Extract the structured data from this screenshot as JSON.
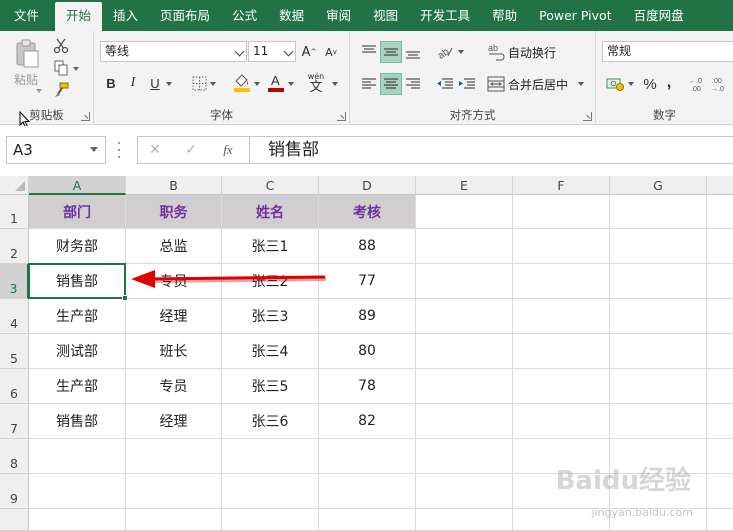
{
  "ribbon_tabs": [
    "文件",
    "开始",
    "插入",
    "页面布局",
    "公式",
    "数据",
    "审阅",
    "视图",
    "开发工具",
    "帮助",
    "Power Pivot",
    "百度网盘"
  ],
  "active_tab": "开始",
  "clipboard": {
    "paste_label": "粘贴",
    "group_label": "剪贴板"
  },
  "font": {
    "name": "等线",
    "size": "11",
    "bold": "B",
    "italic": "I",
    "underline": "U",
    "phonetic": "wén",
    "group_label": "字体",
    "fill_color": "#ffc000",
    "font_color": "#c00000"
  },
  "alignment": {
    "wrap_text": "自动换行",
    "merge_center": "合并后居中",
    "group_label": "对齐方式"
  },
  "number": {
    "format": "常规",
    "percent": "%",
    "comma": ",",
    "group_label": "数字"
  },
  "formula_bar": {
    "name_box": "A3",
    "fx": "fx",
    "content": "销售部"
  },
  "columns": [
    "A",
    "B",
    "C",
    "D",
    "E",
    "F",
    "G"
  ],
  "selected_column": "A",
  "rows": [
    "1",
    "2",
    "3",
    "4",
    "5",
    "6",
    "7",
    "8",
    "9"
  ],
  "selected_row": "3",
  "table": {
    "headers": [
      "部门",
      "职务",
      "姓名",
      "考核"
    ],
    "rows": [
      [
        "财务部",
        "总监",
        "张三1",
        "88"
      ],
      [
        "销售部",
        "专员",
        "张三2",
        "77"
      ],
      [
        "生产部",
        "经理",
        "张三3",
        "89"
      ],
      [
        "测试部",
        "班长",
        "张三4",
        "80"
      ],
      [
        "生产部",
        "专员",
        "张三5",
        "78"
      ],
      [
        "销售部",
        "经理",
        "张三6",
        "82"
      ]
    ]
  },
  "header_fill": "#d0cece",
  "header_text_color": "#7030a0",
  "annotation_arrow_color": "#e00000",
  "watermark": {
    "brand": "Baidu经验",
    "sub": "jingyan.baidu.com"
  }
}
